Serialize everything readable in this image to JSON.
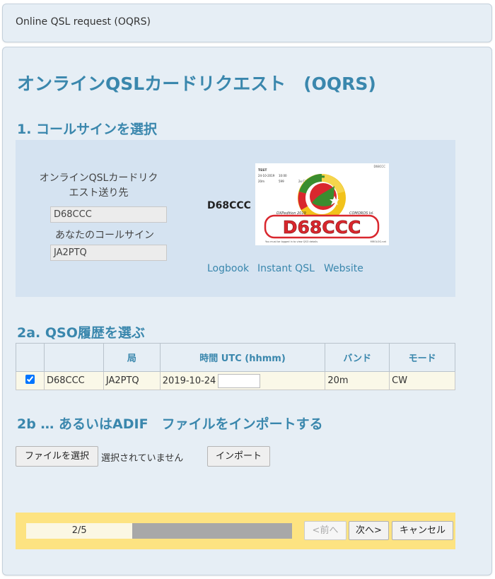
{
  "header": {
    "title": "Online QSL request (OQRS)"
  },
  "page_title": "オンラインQSLカードリクエスト　(OQRS)",
  "step1": {
    "heading": "1. コールサインを選択",
    "request_label": "オンラインQSLカードリクエスト送り先",
    "request_value": "D68CCC",
    "your_call_label": "あなたのコールサイン",
    "your_call_value": "JA2PTQ",
    "dx_callsign": "D68CCC",
    "card": {
      "corner_call": "D68CCC",
      "label_test": "TEST",
      "date": "24-10-2019",
      "time": "10:00",
      "band": "20m",
      "rst": "599",
      "mode": "2x CW",
      "dxpedition": "DXPedition 2019",
      "comoros": "COMOROS Isl.",
      "big_call": "D68CCC",
      "footer_note": "You must be logged in to view QSO details",
      "footer_brand": "MROLOG.net"
    },
    "links": [
      "Logbook",
      "Instant QSL",
      "Website"
    ]
  },
  "step2a": {
    "heading": "2a. QSO履歴を選ぶ",
    "columns": [
      "",
      "",
      "局",
      "時間 UTC (hhmm)",
      "バンド",
      "モード"
    ],
    "rows": [
      {
        "checked": true,
        "dx_call": "D68CCC",
        "station": "JA2PTQ",
        "date": "2019-10-24",
        "time": "",
        "band": "20m",
        "mode": "CW"
      }
    ]
  },
  "step2b": {
    "heading": "2b … あるいはADIF　ファイルをインポートする",
    "choose_file_label": "ファイルを選択",
    "no_file_text": "選択されていません",
    "import_label": "インポート"
  },
  "wizard": {
    "progress_text": "2/5",
    "progress_fraction": 0.4,
    "prev_label": "<前へ",
    "next_label": "次へ>",
    "cancel_label": "キャンセル"
  },
  "colors": {
    "accent": "#3a87ad",
    "panel_bg": "#e6eef5",
    "section_bg": "#d5e3f1",
    "wizard_bg": "#fde381",
    "card_red": "#d9272e",
    "card_green": "#3a8d2f",
    "card_yellow": "#f2c21b"
  }
}
